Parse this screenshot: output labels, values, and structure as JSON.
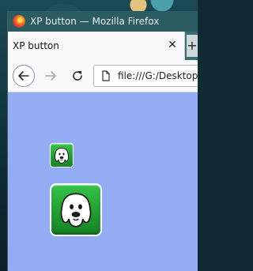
{
  "window": {
    "title": "XP button — Mozilla Firefox",
    "logo_icon": "firefox-logo-icon"
  },
  "tabs": [
    {
      "label": "XP button",
      "close_icon": "close-icon",
      "active": true
    }
  ],
  "new_tab_icon": "plus-icon",
  "navigation": {
    "back_icon": "back-arrow-icon",
    "forward_icon": "forward-arrow-icon",
    "reload_icon": "reload-icon"
  },
  "urlbar": {
    "page_icon": "page-icon",
    "url": "file:///G:/Desktop"
  },
  "content": {
    "background_color": "#94acf3",
    "buttons": [
      {
        "id": "small",
        "icon": "dog-face-icon",
        "color": "#1f9e2f"
      },
      {
        "id": "large",
        "icon": "dog-face-icon",
        "color": "#1f9e2f"
      }
    ]
  }
}
